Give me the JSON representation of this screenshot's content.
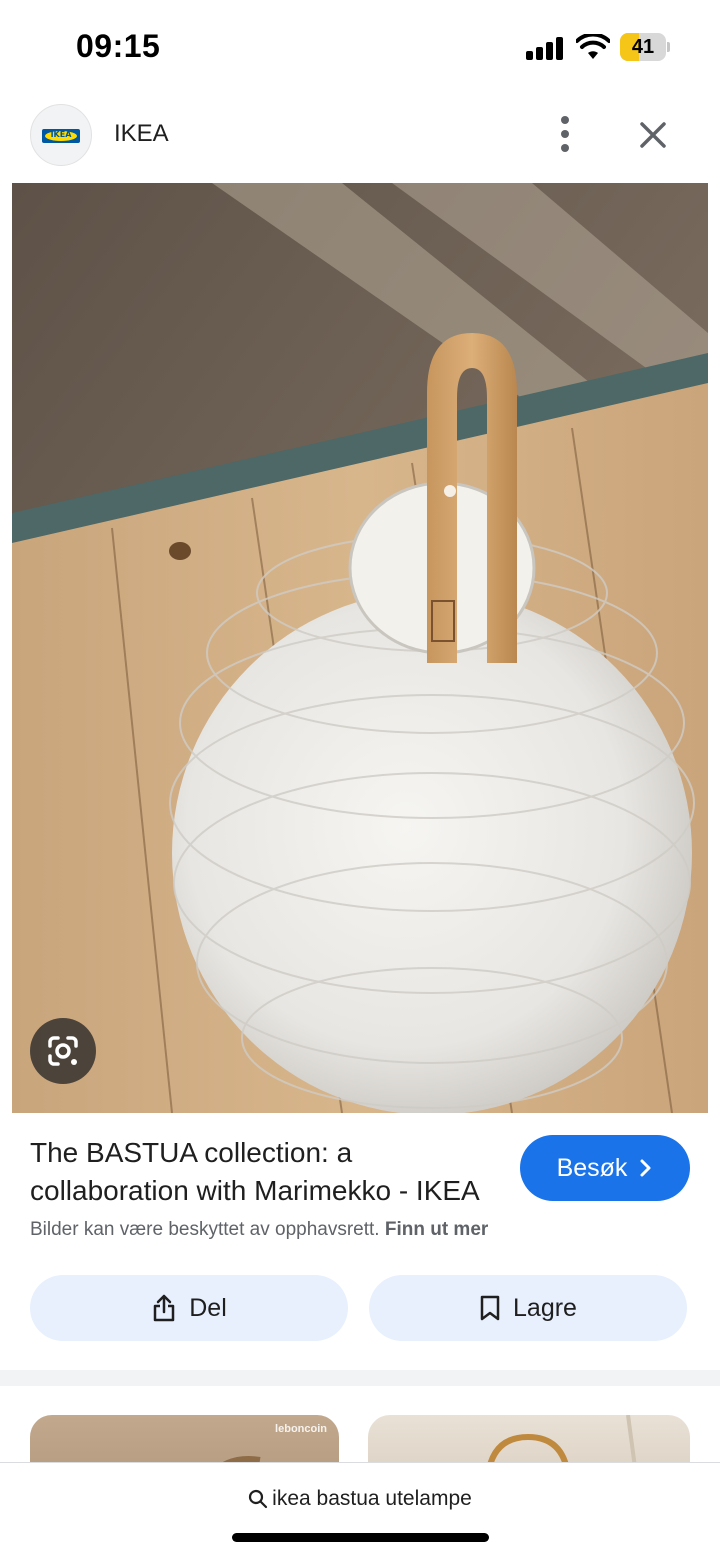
{
  "status_bar": {
    "time": "09:15",
    "battery_level": "41",
    "battery_fraction": 0.41,
    "battery_color": "#f5c518",
    "icons": [
      "signal-icon",
      "wifi-icon",
      "battery-icon"
    ]
  },
  "header": {
    "site_name": "IKEA",
    "logo_text": "IKEA",
    "icons": [
      "more-vertical-icon",
      "close-icon"
    ]
  },
  "result": {
    "title": "The BASTUA collection: a collaboration with Marimekko - IKEA",
    "visit_label": "Besøk",
    "copyright_text": "Bilder kan være beskyttet av opphavsrett.",
    "copyright_link": "Finn ut mer"
  },
  "actions": {
    "share_label": "Del",
    "save_label": "Lagre"
  },
  "related": {
    "thumb_1_watermark": "leboncoin"
  },
  "bottom": {
    "query": "ikea bastua utelampe"
  },
  "colors": {
    "accent": "#1a73e8",
    "action_bg": "#e8f0fe",
    "ikea_blue": "#0058a3",
    "ikea_yellow": "#ffdb00"
  }
}
